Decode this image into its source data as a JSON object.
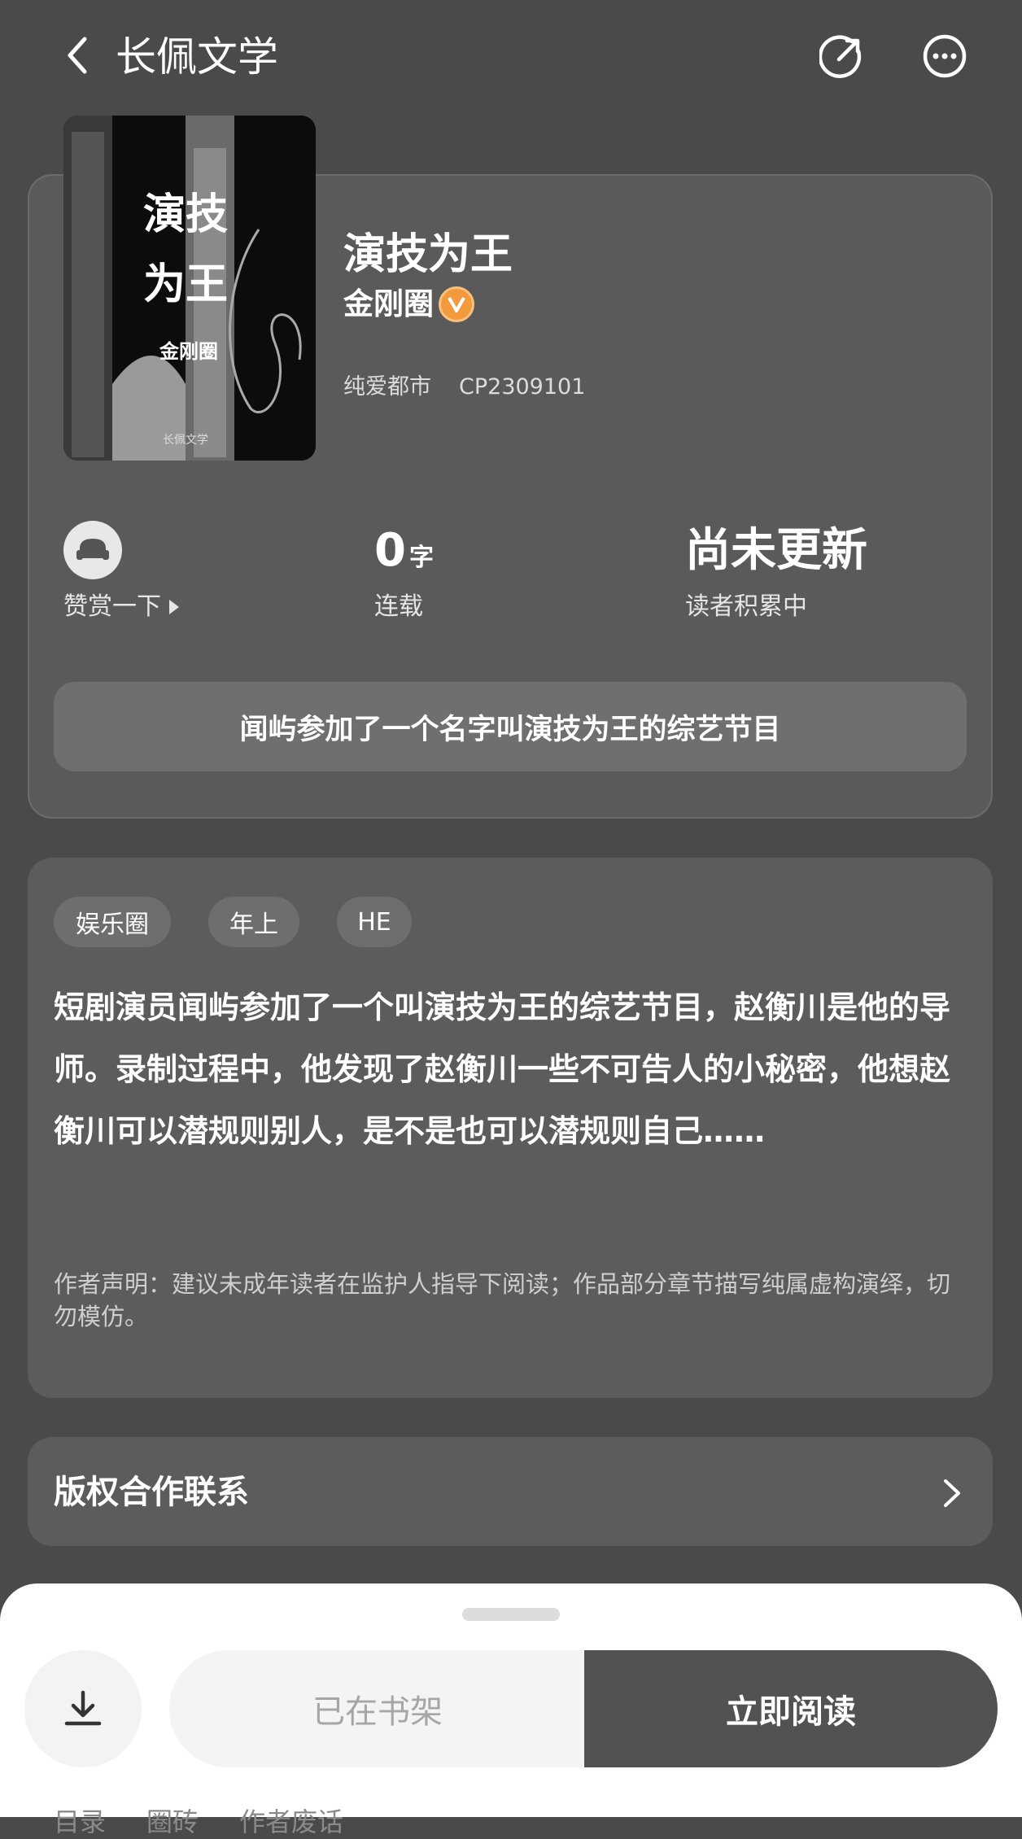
{
  "header": {
    "app_title": "长佩文学"
  },
  "book": {
    "cover_title_line1": "演技",
    "cover_title_line2": "为王",
    "cover_author": "金刚圈",
    "cover_brand": "长佩文学",
    "title": "演技为王",
    "author": "金刚圈",
    "category": "纯爱都市",
    "cp_code": "CP2309101"
  },
  "stats": {
    "tip_label": "赞赏一下",
    "word_count": "0",
    "word_unit": "字",
    "status_label": "连载",
    "update_text": "尚未更新",
    "readers_label": "读者积累中"
  },
  "tagline": "闻屿参加了一个名字叫演技为王的综艺节目",
  "tags": [
    "娱乐圈",
    "年上",
    "HE"
  ],
  "intro": "短剧演员闻屿参加了一个叫演技为王的综艺节目，赵衡川是他的导师。录制过程中，他发现了赵衡川一些不可告人的小秘密，他想赵衡川可以潜规则别人，是不是也可以潜规则自己……",
  "notice": "作者声明：建议未成年读者在监护人指导下阅读；作品部分章节描写纯属虚构演绎，切勿模仿。",
  "copyright_label": "版权合作联系",
  "actions": {
    "shelf_label": "已在书架",
    "read_label": "立即阅读"
  },
  "bottom_tabs": [
    "目录",
    "圈砖",
    "作者废话"
  ],
  "colors": {
    "background": "#4a4a4a",
    "card": "#5a5a5a",
    "badge": "#f29a3c",
    "read_button": "#525252"
  }
}
